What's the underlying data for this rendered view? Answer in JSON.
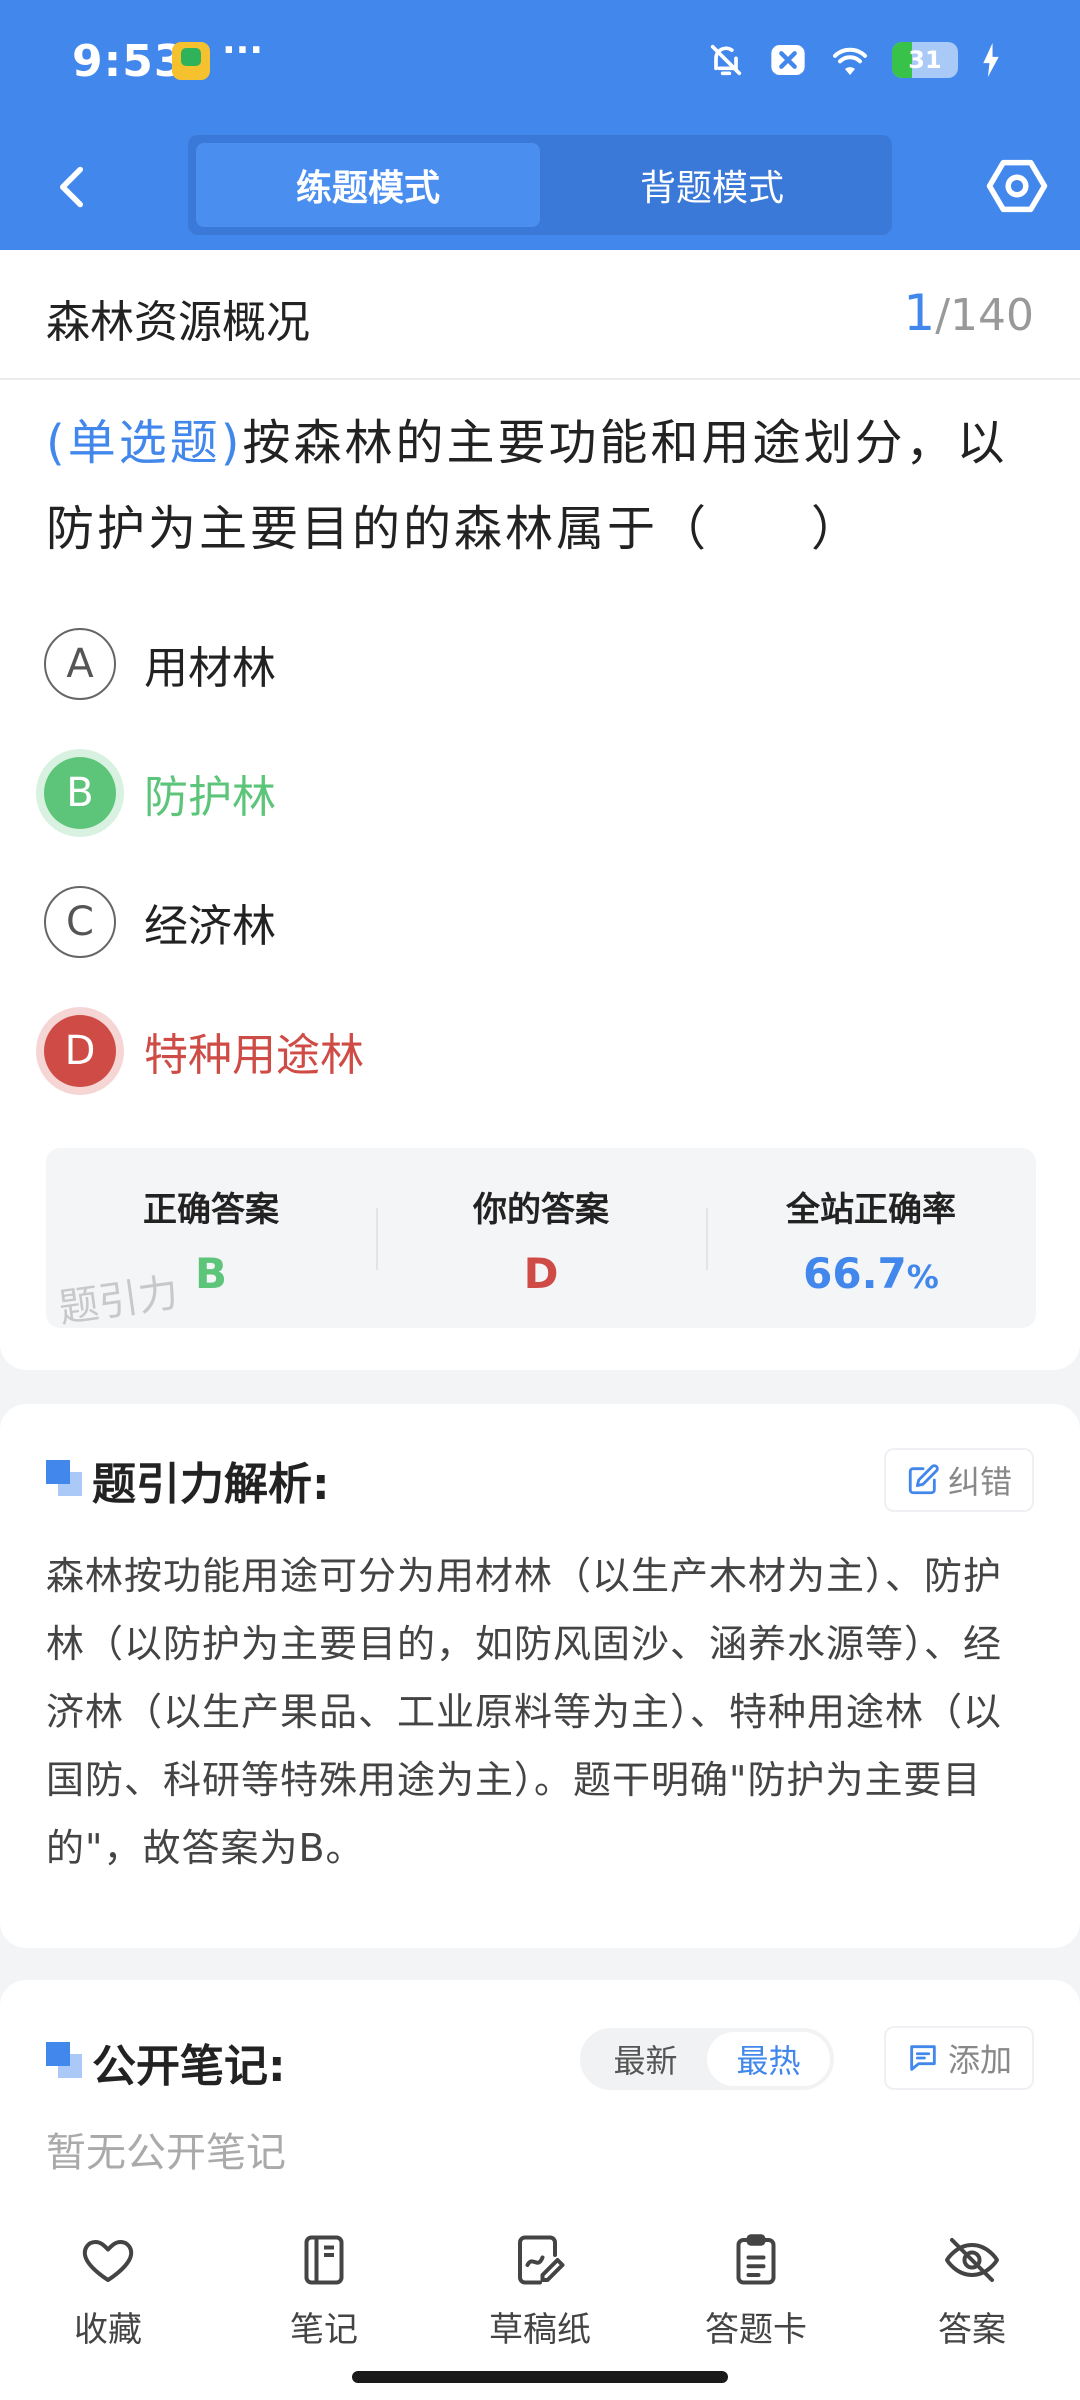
{
  "status_bar": {
    "time": "9:53",
    "more": "···",
    "battery": "31",
    "battery_level": 0.31,
    "icons": [
      "app-icon",
      "bell-muted-icon",
      "close-badge-icon",
      "wifi-icon",
      "battery-icon",
      "charging-icon"
    ]
  },
  "header": {
    "tabs": [
      {
        "label": "练题模式",
        "active": true
      },
      {
        "label": "背题模式",
        "active": false
      }
    ],
    "icons": {
      "back": "chevron-left-icon",
      "settings": "hexagon-settings-icon"
    },
    "color": "#4287ec"
  },
  "question_card": {
    "section_title": "森林资源概况",
    "counter_current": "1",
    "counter_total": "/140",
    "question_type": "(单选题)",
    "question_text": "按森林的主要功能和用途划分，以防护为主要目的的森林属于（　　）",
    "options": [
      {
        "letter": "A",
        "text": "用材林",
        "state": "normal"
      },
      {
        "letter": "B",
        "text": "防护林",
        "state": "correct"
      },
      {
        "letter": "C",
        "text": "经济林",
        "state": "normal"
      },
      {
        "letter": "D",
        "text": "特种用途林",
        "state": "wrong"
      }
    ],
    "answer_summary": {
      "correct_label": "正确答案",
      "correct_value": "B",
      "your_label": "你的答案",
      "your_value": "D",
      "rate_label": "全站正确率",
      "rate_value": "66.7",
      "rate_unit": "%"
    },
    "watermark": "题引力",
    "colors": {
      "correct": "#5cc57a",
      "wrong": "#cf4b46",
      "accent": "#4287ec"
    }
  },
  "analysis": {
    "title": "题引力解析:",
    "report_button": "纠错",
    "text": "森林按功能用途可分为用材林（以生产木材为主）、防护林（以防护为主要目的，如防风固沙、涵养水源等）、经济林（以生产果品、工业原料等为主）、特种用途林（以国防、科研等特殊用途为主）。题干明确\"防护为主要目的\"，故答案为B。"
  },
  "notes": {
    "title": "公开笔记:",
    "sort_options": [
      {
        "label": "最新",
        "active": false
      },
      {
        "label": "最热",
        "active": true
      }
    ],
    "add_button": "添加",
    "empty_text": "暂无公开笔记"
  },
  "bottom_bar": {
    "items": [
      {
        "label": "收藏",
        "icon": "heart-icon"
      },
      {
        "label": "笔记",
        "icon": "notebook-icon"
      },
      {
        "label": "草稿纸",
        "icon": "draft-paper-icon"
      },
      {
        "label": "答题卡",
        "icon": "answer-sheet-icon"
      },
      {
        "label": "答案",
        "icon": "eye-off-icon"
      }
    ]
  }
}
